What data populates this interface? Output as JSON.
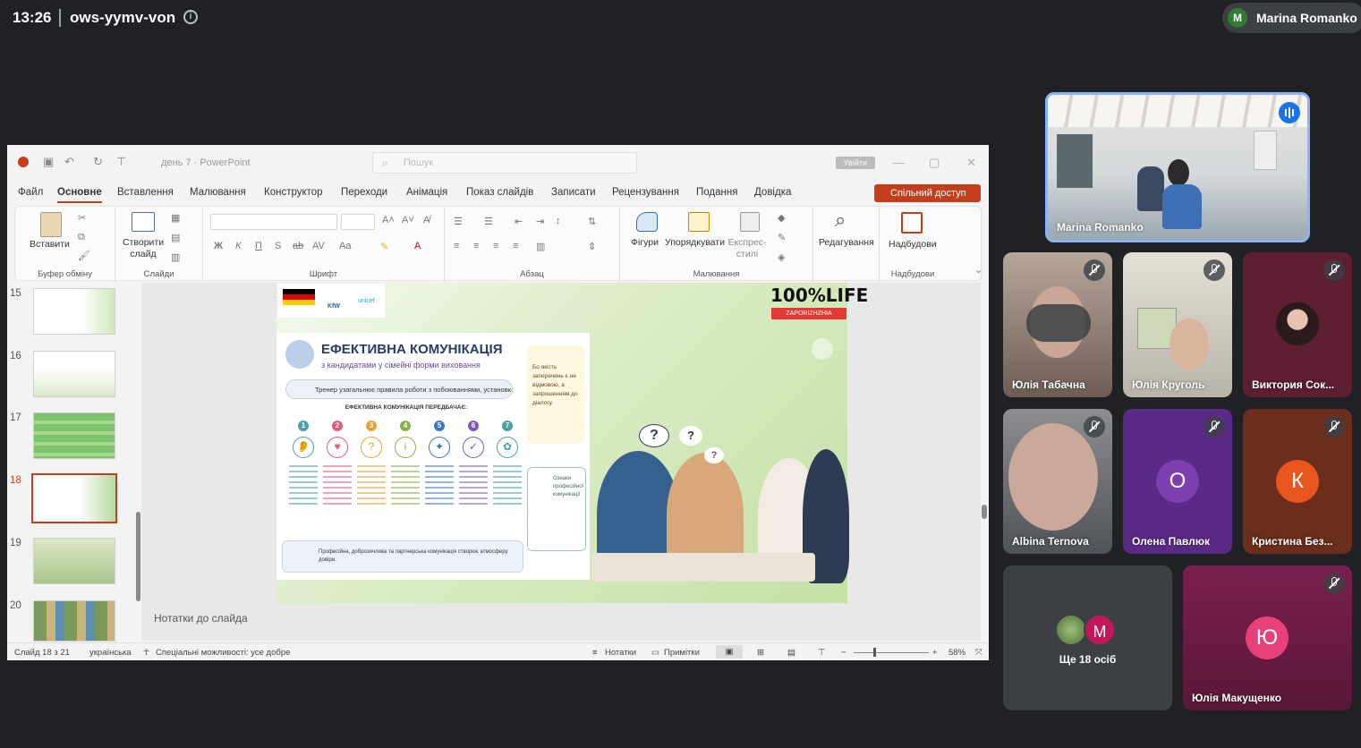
{
  "meet": {
    "time": "13:26",
    "code": "ows-yymv-von",
    "presenter_initial": "M",
    "presenter_name": "Marina Romanko ("
  },
  "ppt": {
    "doc_name": "день 7 · PowerPoint",
    "search_placeholder": "Пошук",
    "signin": "Увійти",
    "tabs": [
      "Файл",
      "Основне",
      "Вставлення",
      "Малювання",
      "Конструктор",
      "Переходи",
      "Анімація",
      "Показ слайдів",
      "Записати",
      "Рецензування",
      "Подання",
      "Довідка"
    ],
    "share": "Спільний доступ",
    "ribbon": {
      "paste": "Вставити",
      "clipboard": "Буфер обміну",
      "new_slide": "Створити слайд",
      "slides": "Слайди",
      "font": "Шрифт",
      "paragraph": "Абзац",
      "shapes": "Фігури",
      "arrange": "Упорядкувати",
      "quick_styles": "Експрес-стилі",
      "drawing": "Малювання",
      "editing": "Редагування",
      "addins_btn": "Надбудови",
      "addins": "Надбудови",
      "font_buttons": [
        "Ж",
        "К",
        "П",
        "S"
      ]
    },
    "slide_numbers": [
      "15",
      "16",
      "17",
      "18",
      "19",
      "20"
    ],
    "selected_slide": "18",
    "notes": "Нотатки до слайда",
    "status": {
      "slide": "Слайд 18 з 21",
      "lang": "українська",
      "access": "Спеціальні можливості: усе добре",
      "notes": "Нотатки",
      "comments": "Примітки",
      "zoom": "58%"
    }
  },
  "slide": {
    "brand": "100%LIFE",
    "brand_sub": "ZAPORIZHZHIA",
    "logo_kfw": "KfW",
    "logo_unicef": "unicef",
    "title": "ЕФЕКТИВНА КОМУНІКАЦІЯ",
    "subtitle": "з кандидатами у сімейні форми виховання",
    "rule": "Тренер узагальнює правила роботи з побоюваннями, установками:",
    "quote": "Бо якість заперечень є не відмовою, а запрошенням до діалогу.",
    "section": "ЕФЕКТИВНА КОМУНІКАЦІЯ ПЕРЕДБАЧАЄ:",
    "steps": [
      "1",
      "2",
      "3",
      "4",
      "5",
      "6",
      "7"
    ],
    "step_glyphs": [
      "👂",
      "♥",
      "?",
      "i",
      "✦",
      "✓",
      "✿"
    ],
    "bottom": "Професійна, доброзичлива та партнерська комунікація створює атмосферу довіри.",
    "side": "Ознаки професійної комунікації",
    "bubbles": [
      "?",
      "?",
      "?"
    ]
  },
  "tiles": {
    "presenter": "Marina Romanko",
    "people": [
      {
        "name": "Юлія Табачна"
      },
      {
        "name": "Юлія Круголь"
      },
      {
        "name": "Виктория Сок..."
      },
      {
        "name": "Albina Ternova"
      },
      {
        "name": "Олена Павлюк",
        "initial": "О"
      },
      {
        "name": "Кристина Без...",
        "initial": "К"
      }
    ],
    "more_initial": "M",
    "more_label": "Ще 18 осіб",
    "last": {
      "name": "Юлія Макущенко",
      "initial": "Ю"
    }
  },
  "colors": {
    "accent": "#c43e1c",
    "meet_bg": "#202124",
    "tile_purple": "#5b2a86",
    "tile_brown": "#6b2d1c",
    "tile_maroon": "#5e1f33"
  }
}
